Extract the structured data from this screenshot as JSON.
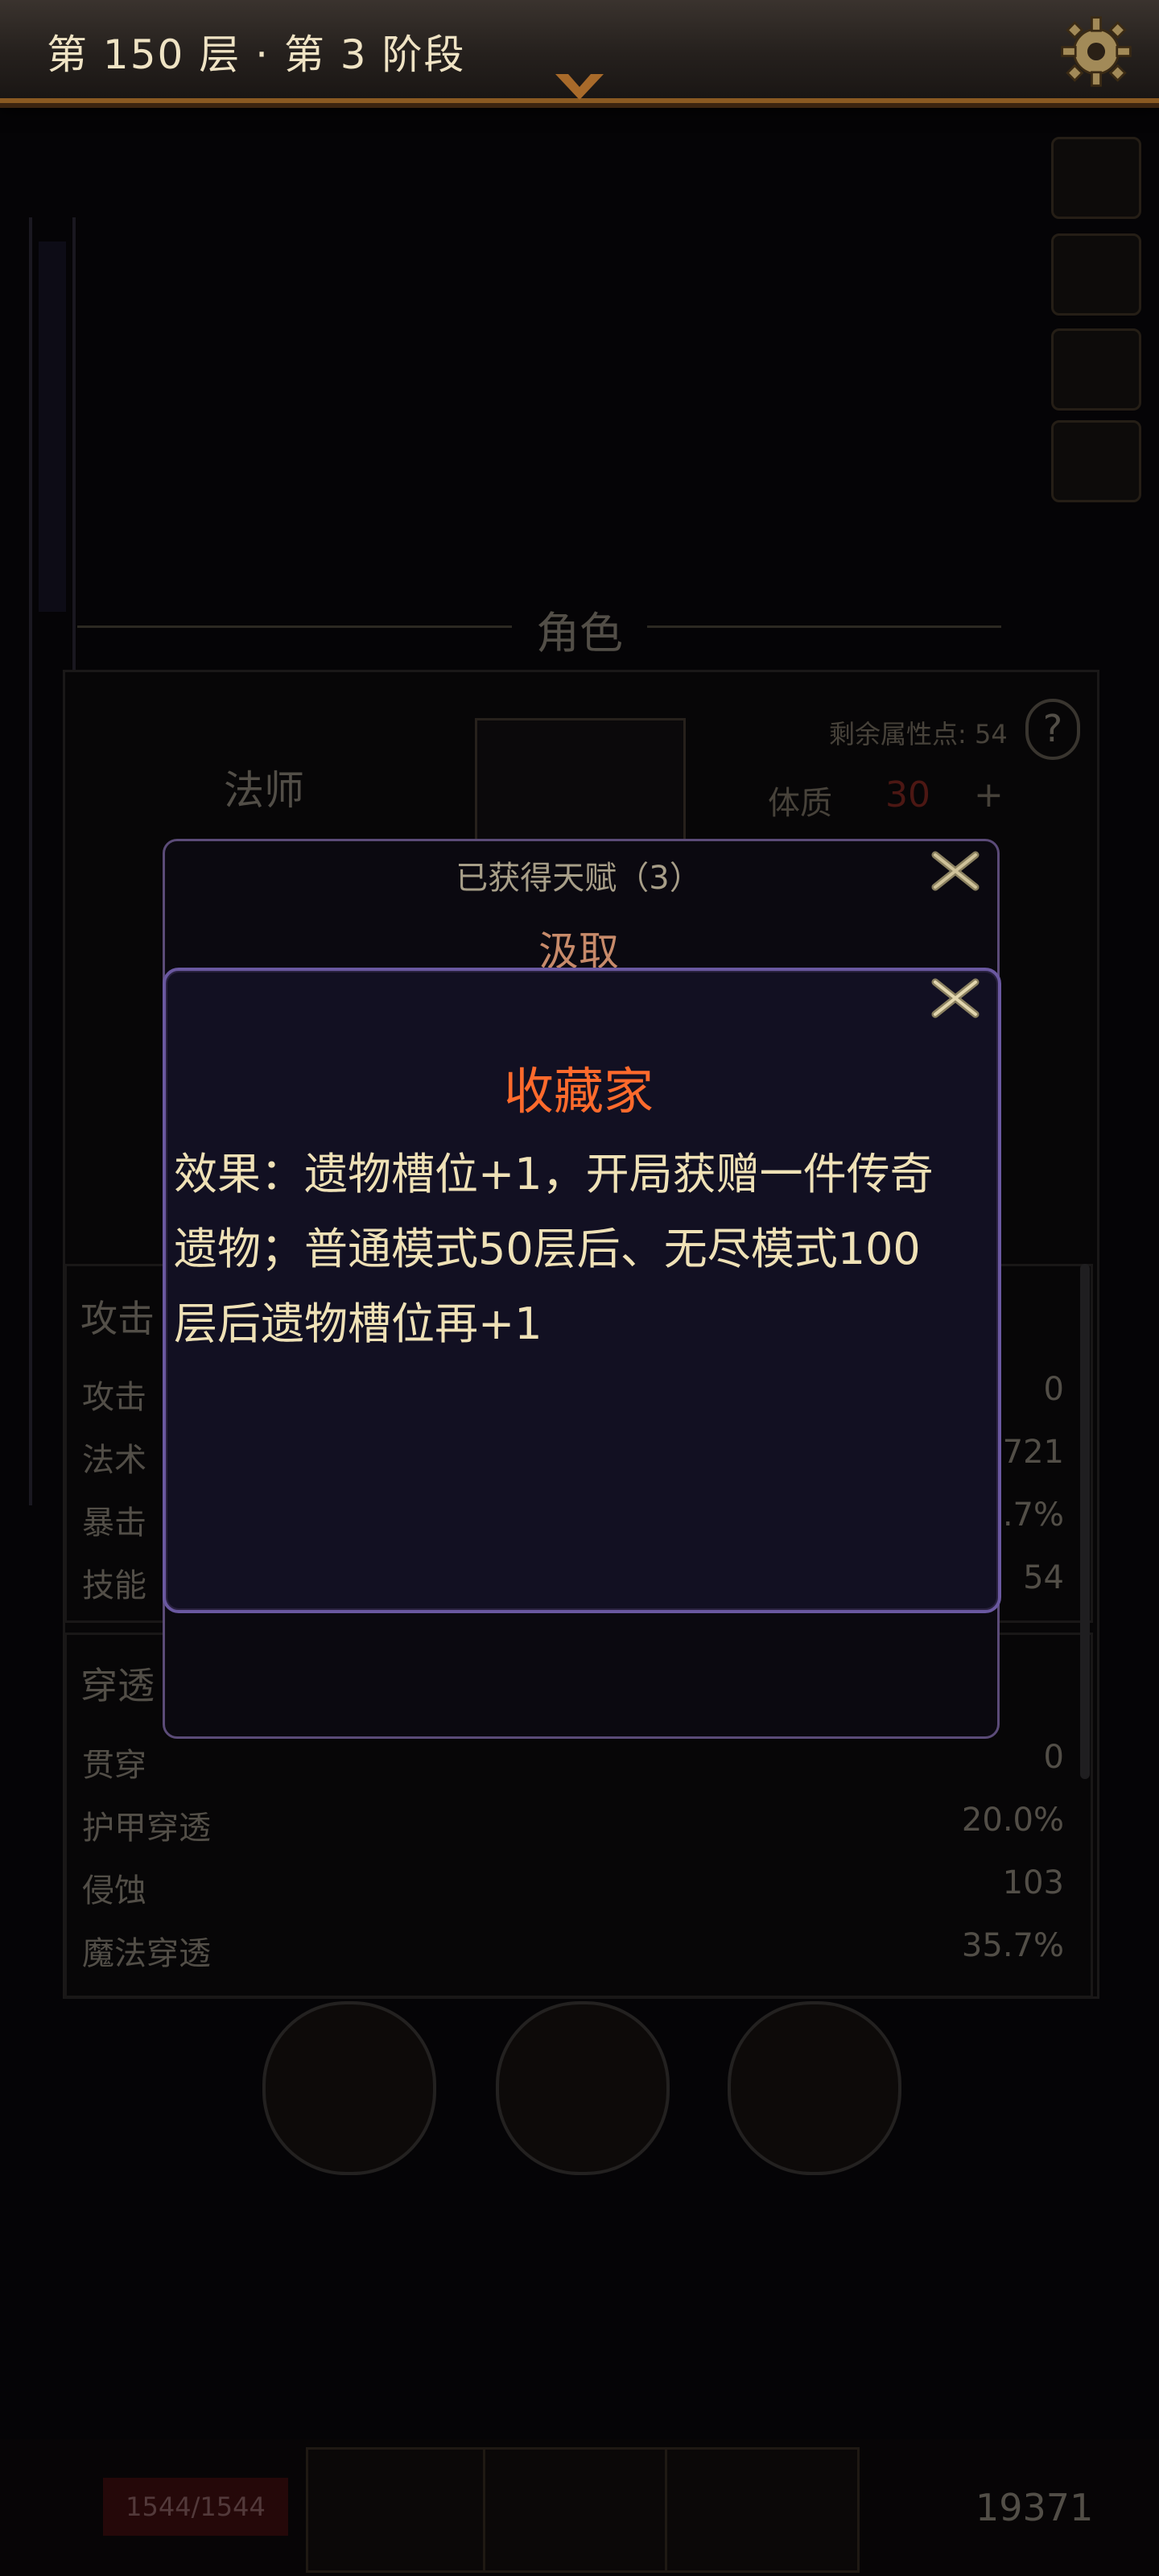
{
  "header": {
    "stage_title": "第 150 层 · 第 3 阶段",
    "settings_icon": "gear-icon"
  },
  "character_panel": {
    "title": "角色",
    "class_name": "法师",
    "remaining_points_label": "剩余属性点: 54",
    "help_label": "?",
    "vitality_label": "体质",
    "vitality_value": "30",
    "vitality_plus": "+"
  },
  "stats": {
    "attack_section": "攻击",
    "attack_rows": [
      {
        "label": "攻击",
        "value": "0"
      },
      {
        "label": "法术",
        "value": "721"
      },
      {
        "label": "暴击",
        "value": "4.7%"
      },
      {
        "label": "技能",
        "value": "54"
      }
    ],
    "penetration_section": "穿透",
    "penetration_rows": [
      {
        "label": "贯穿",
        "value": "0"
      },
      {
        "label": "护甲穿透",
        "value": "20.0%"
      },
      {
        "label": "侵蚀",
        "value": "103"
      },
      {
        "label": "魔法穿透",
        "value": "35.7%"
      }
    ]
  },
  "bottom_bar": {
    "hp": "1544/1544",
    "gold": "19371"
  },
  "talents_window": {
    "title": "已获得天赋（3）",
    "subtitle": "汲取"
  },
  "talent_detail": {
    "name": "收藏家",
    "description_lines": [
      "效果：遗物槽位+1，开局获赠一件传奇",
      "遗物；普通模式50层后、无尽模式100",
      "层后遗物槽位再+1"
    ]
  },
  "colors": {
    "talent_name": "#ff6a2c",
    "description": "#efe1b6",
    "popup_border": "#6a58a0",
    "header_border": "#8a5a22"
  }
}
